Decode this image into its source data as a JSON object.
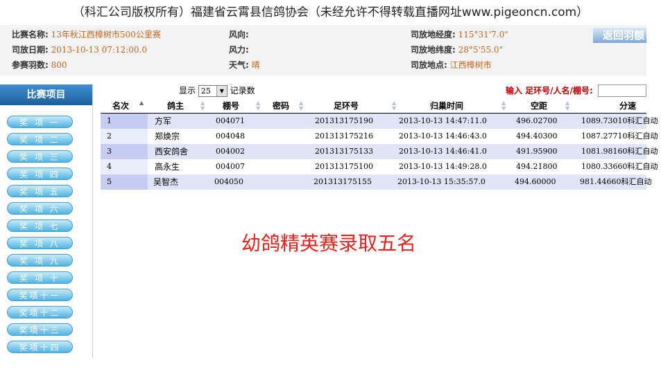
{
  "banner": "（科汇公司版权所有）福建省云霄县信鸽协会（未经允许不得转载直播网址www.pigeoncn.com）",
  "info": {
    "race_name_label": "比赛名称:",
    "race_name": "13年秋江西樟树市500公里赛",
    "release_date_label": "司放日期:",
    "release_date": "2013-10-13 07:12:00.0",
    "count_label": "参赛羽数:",
    "count": "800",
    "wind_dir_label": "风向:",
    "wind_dir": "",
    "wind_force_label": "风力:",
    "wind_force": "",
    "weather_label": "天气:",
    "weather": "晴",
    "longitude_label": "司放地经度:",
    "longitude": "115°31'7.0\"",
    "latitude_label": "司放地纬度:",
    "latitude": "28°5'55.0\"",
    "location_label": "司放地点:",
    "location": "江西樟树市",
    "return_button": "返回羽额"
  },
  "sidebar": {
    "title": "比赛项目",
    "items": [
      "奖 项 一",
      "奖 项 二",
      "奖 项 三",
      "奖 项 四",
      "奖 项 五",
      "奖 项 六",
      "奖 项 七",
      "奖 项 八",
      "奖 项 九",
      "奖 项 十",
      "奖项十一",
      "奖项十二",
      "奖项十三",
      "奖项十四"
    ]
  },
  "controls": {
    "show_label": "显示",
    "page_size": "25",
    "records_label": "记录数",
    "search_label": "输入 足环号/人名/棚号:",
    "search_value": ""
  },
  "table": {
    "columns": [
      "名次",
      "鸽主",
      "棚号",
      "密码",
      "足环号",
      "归巢时间",
      "空距",
      "分速"
    ],
    "rows": [
      {
        "rank": "1",
        "owner": "方军",
        "loft": "004071",
        "code": "",
        "ring": "201313175190",
        "time": "2013-10-13 14:47:11.0",
        "distance": "496.02700",
        "speed": "1089.73010科汇自动"
      },
      {
        "rank": "2",
        "owner": "郑焕宗",
        "loft": "004048",
        "code": "",
        "ring": "201313175216",
        "time": "2013-10-13 14:46:43.0",
        "distance": "494.40300",
        "speed": "1087.27710科汇自动"
      },
      {
        "rank": "3",
        "owner": "西安鸽舍",
        "loft": "004002",
        "code": "",
        "ring": "201313175133",
        "time": "2013-10-13 14:46:41.0",
        "distance": "491.95900",
        "speed": "1081.98160科汇自动"
      },
      {
        "rank": "4",
        "owner": "高永生",
        "loft": "004007",
        "code": "",
        "ring": "201313175100",
        "time": "2013-10-13 14:49:28.0",
        "distance": "494.21800",
        "speed": "1080.33660科汇自动"
      },
      {
        "rank": "5",
        "owner": "吴智杰",
        "loft": "004050",
        "code": "",
        "ring": "201313175155",
        "time": "2013-10-13 15:35:57.0",
        "distance": "494.60000",
        "speed": "981.44660科汇自动"
      }
    ]
  },
  "overlay": "幼鸽精英赛录取五名"
}
